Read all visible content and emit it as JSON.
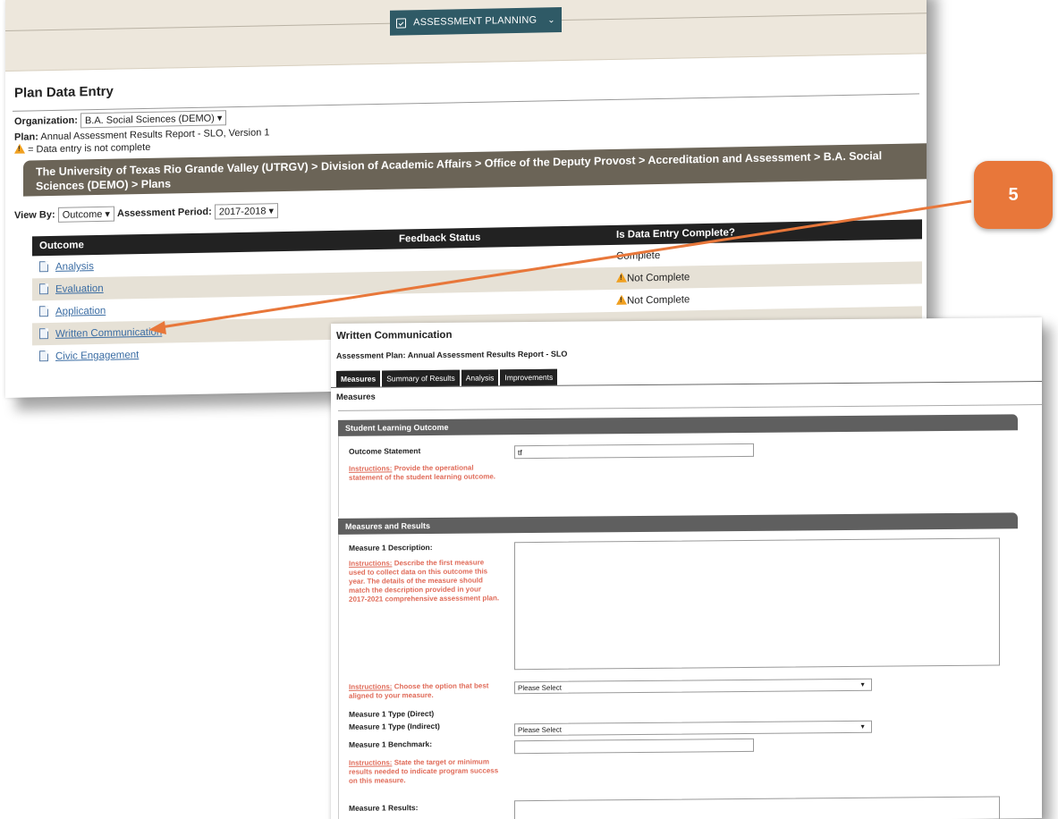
{
  "nav": {
    "button_label": "ASSESSMENT PLANNING"
  },
  "plan_entry": {
    "title": "Plan Data Entry",
    "organization_label": "Organization:",
    "organization_value": "B.A. Social Sciences (DEMO)",
    "plan_label": "Plan:",
    "plan_value": "Annual Assessment Results Report - SLO,  Version 1",
    "legend_text": "= Data entry is not complete",
    "breadcrumb": "The University of Texas Rio Grande Valley (UTRGV) > Division of Academic Affairs > Office of the Deputy Provost > Accreditation and Assessment > B.A. Social Sciences (DEMO) > Plans",
    "view_by_label": "View By:",
    "view_by_value": "Outcome",
    "period_label": "Assessment Period:",
    "period_value": "2017-2018",
    "table": {
      "headers": [
        "Outcome",
        "Feedback Status",
        "Is Data Entry Complete?"
      ],
      "rows": [
        {
          "outcome": "Analysis",
          "feedback": "",
          "status": "Complete"
        },
        {
          "outcome": "Evaluation",
          "feedback": "",
          "status": "Not Complete"
        },
        {
          "outcome": "Application",
          "feedback": "",
          "status": "Not Complete"
        },
        {
          "outcome": "Written Communication",
          "feedback": "",
          "status": ""
        },
        {
          "outcome": "Civic Engagement",
          "feedback": "",
          "status": ""
        }
      ]
    }
  },
  "written_comm": {
    "title": "Written Communication",
    "plan_line": "Assessment Plan: Annual Assessment Results Report - SLO",
    "tabs": [
      "Measures",
      "Summary of Results",
      "Analysis",
      "Improvements"
    ],
    "section_label": "Measures",
    "slo_header": "Student Learning Outcome",
    "outcome_statement_label": "Outcome Statement",
    "outcome_statement_value": "tf",
    "outcome_instr_prefix": "Instructions:",
    "outcome_instr_text": "Provide the operational statement of the student learning outcome.",
    "mr_header": "Measures and Results",
    "m1_desc_label": "Measure 1 Description:",
    "m1_desc_instr_prefix": "Instructions:",
    "m1_desc_instr_text": "Describe the first measure used to collect data on this outcome this year. The details of the measure should match the description provided in your 2017-2021 comprehensive assessment plan.",
    "choose_instr_prefix": "Instructions:",
    "choose_instr_text": "Choose the option that best aligned to your measure.",
    "select_placeholder_1": "Please Select",
    "m1_type_direct_label": "Measure 1 Type (Direct)",
    "m1_type_indirect_label": "Measure 1 Type (Indirect)",
    "select_placeholder_2": "Please Select",
    "m1_benchmark_label": "Measure 1 Benchmark:",
    "benchmark_instr_prefix": "Instructions:",
    "benchmark_instr_text": "State the target or minimum results needed to indicate program success on this measure.",
    "m1_results_label": "Measure 1 Results:"
  },
  "annotation": {
    "step_number": "5",
    "color": "#e8773a"
  }
}
